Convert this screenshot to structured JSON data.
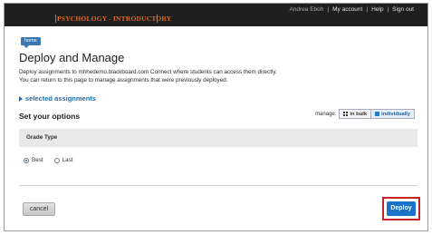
{
  "header": {
    "course_title": "PSYCHOLOGY - INTRODUCTORY",
    "user_name": "Andrea Eboh",
    "my_account": "My account",
    "help": "Help",
    "sign_out": "Sign out"
  },
  "breadcrumb": {
    "home": "home"
  },
  "page": {
    "title": "Deploy and Manage",
    "description_line1": "Deploy assignments to mhhedemo.blackboard.com Connect where students can access them directly.",
    "description_line2": "You can return to this page to manage assignments that were previously deployed.",
    "selected_assignments": "selected assignments"
  },
  "options": {
    "title": "Set your options",
    "manage_label": "manage:",
    "in_bulk": "in bulk",
    "individually": "individually",
    "grade_type_label": "Grade Type",
    "grade_types": [
      {
        "label": "Best",
        "selected": true
      },
      {
        "label": "Last",
        "selected": false
      }
    ]
  },
  "actions": {
    "cancel": "cancel",
    "deploy": "Deploy"
  },
  "colors": {
    "accent": "#1a73c7",
    "highlight": "#c4232b",
    "course_title": "#e06a2a"
  }
}
